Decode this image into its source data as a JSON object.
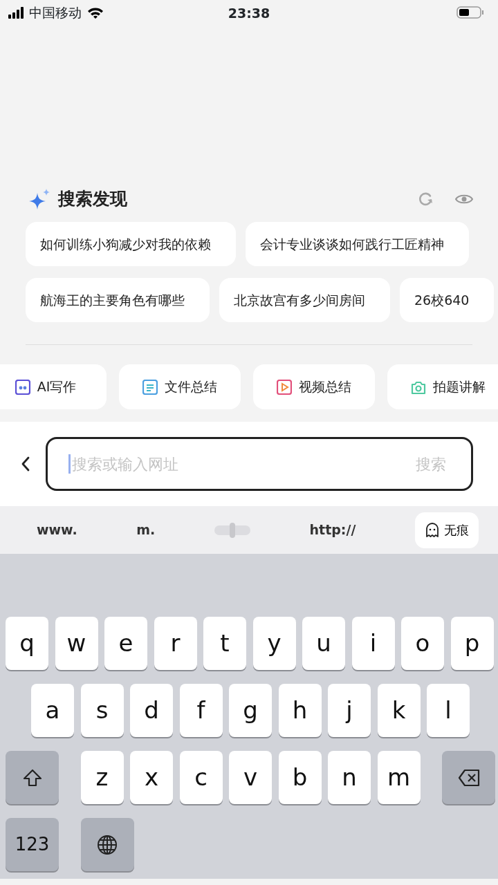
{
  "status_bar": {
    "carrier": "中国移动",
    "time": "23:38"
  },
  "discover": {
    "title": "搜索发现",
    "rows": [
      [
        "如何训练小狗减少对我的依赖",
        "会计专业谈谈如何践行工匠精神"
      ],
      [
        "航海王的主要角色有哪些",
        "北京故宫有多少间房间",
        "26校640"
      ]
    ]
  },
  "tools": [
    {
      "label": "AI写作",
      "kind": "quote"
    },
    {
      "label": "文件总结",
      "kind": "document"
    },
    {
      "label": "视频总结",
      "kind": "video"
    },
    {
      "label": "拍题讲解",
      "kind": "camera"
    }
  ],
  "search": {
    "placeholder": "搜索或输入网址",
    "button": "搜索"
  },
  "shortcuts": [
    "www.",
    "m.",
    "http://"
  ],
  "incognito": "无痕",
  "keyboard": {
    "rows": [
      [
        "q",
        "w",
        "e",
        "r",
        "t",
        "y",
        "u",
        "i",
        "o",
        "p"
      ],
      [
        "a",
        "s",
        "d",
        "f",
        "g",
        "h",
        "j",
        "k",
        "l"
      ],
      [
        "z",
        "x",
        "c",
        "v",
        "b",
        "n",
        "m"
      ]
    ],
    "numbers": "123"
  }
}
